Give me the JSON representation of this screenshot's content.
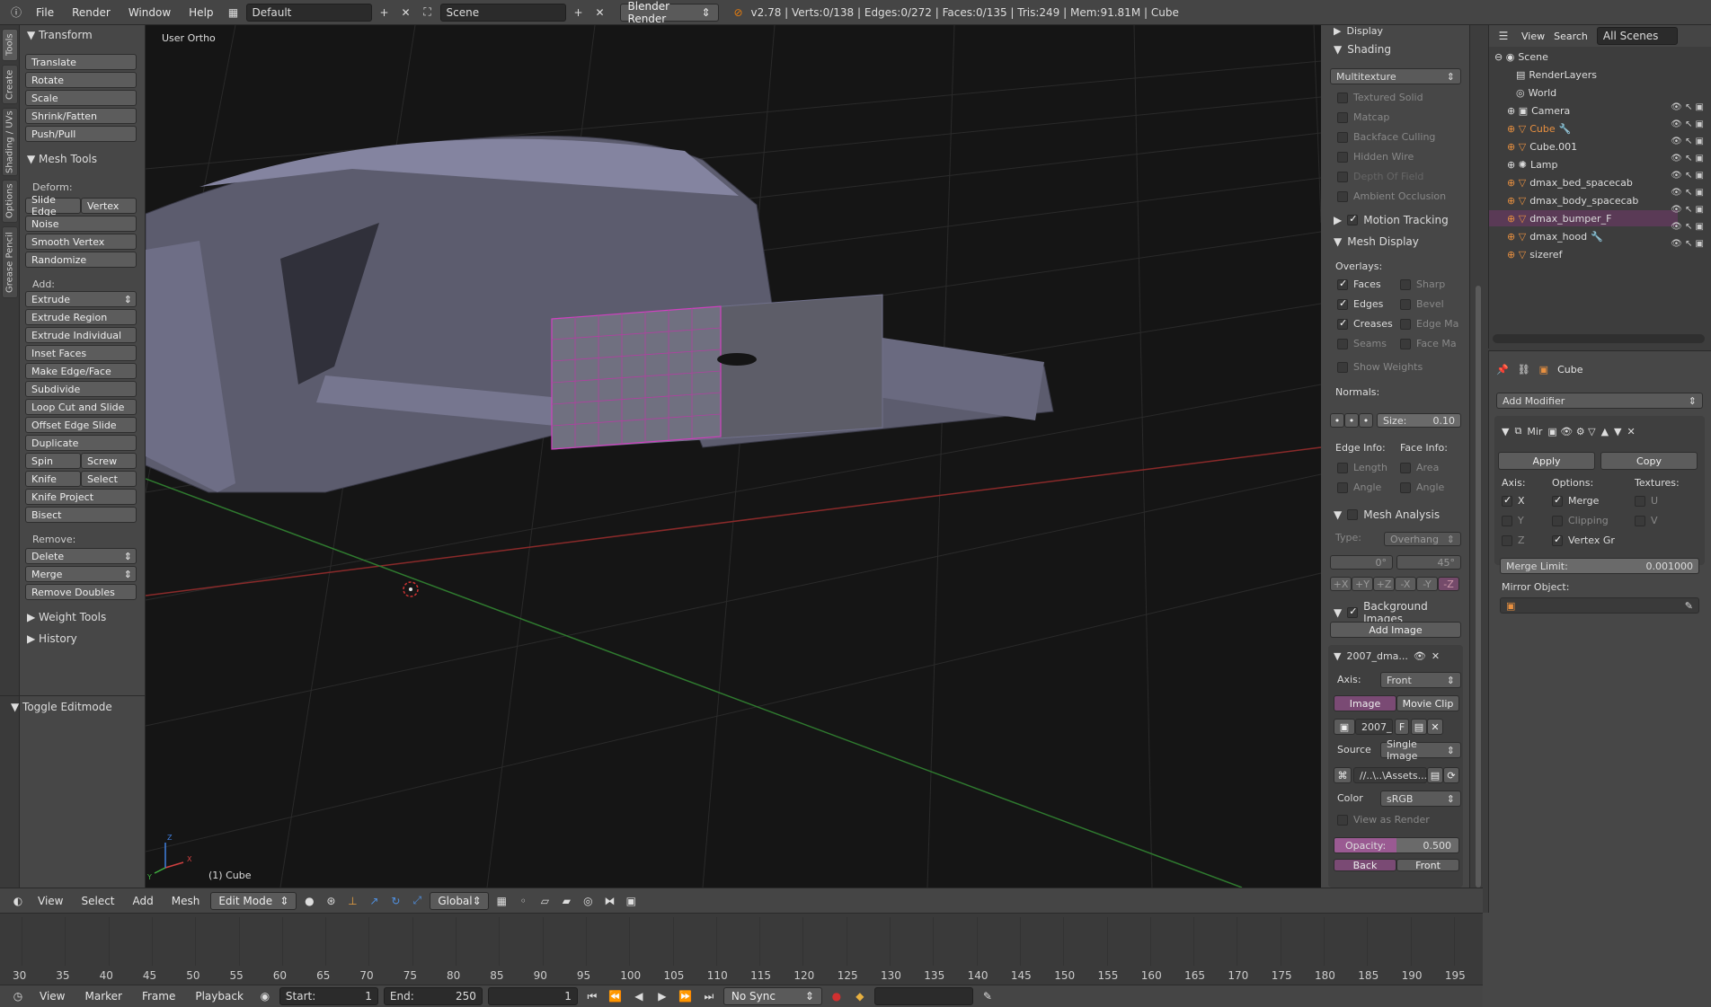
{
  "topbar": {
    "menus": [
      "File",
      "Render",
      "Window",
      "Help"
    ],
    "layout": "Default",
    "scene": "Scene",
    "engine": "Blender Render",
    "stats": "v2.78 | Verts:0/138 | Edges:0/272 | Faces:0/135 | Tris:249 | Mem:91.81M | Cube"
  },
  "tabs": [
    "Tools",
    "Create",
    "Shading / UVs",
    "Options",
    "Grease Pencil"
  ],
  "toolshelf": {
    "transform_header": "Transform",
    "transform": [
      "Translate",
      "Rotate",
      "Scale",
      "Shrink/Fatten",
      "Push/Pull"
    ],
    "mesh_tools_header": "Mesh Tools",
    "deform_label": "Deform:",
    "slide_edge": "Slide Edge",
    "vertex": "Vertex",
    "deform": [
      "Noise",
      "Smooth Vertex",
      "Randomize"
    ],
    "add_label": "Add:",
    "extrude": "Extrude",
    "add": [
      "Extrude Region",
      "Extrude Individual",
      "Inset Faces",
      "Make Edge/Face",
      "Subdivide",
      "Loop Cut and Slide",
      "Offset Edge Slide",
      "Duplicate"
    ],
    "spin": "Spin",
    "screw": "Screw",
    "knife": "Knife",
    "select": "Select",
    "knife_project": "Knife Project",
    "bisect": "Bisect",
    "remove_label": "Remove:",
    "delete": "Delete",
    "merge": "Merge",
    "remove_doubles": "Remove Doubles",
    "weight_tools": "Weight Tools",
    "history": "History",
    "toggle_editmode": "Toggle Editmode"
  },
  "viewport": {
    "view_label": "User Ortho",
    "object_label": "(1) Cube",
    "axis_x": "X",
    "axis_y": "Y",
    "axis_z": "Z"
  },
  "props": {
    "display": "Display",
    "shading": "Shading",
    "shading_mode": "Multitexture",
    "shading_opts": [
      "Textured Solid",
      "Matcap",
      "Backface Culling",
      "Hidden Wire",
      "Depth Of Field",
      "Ambient Occlusion"
    ],
    "motion_tracking": "Motion Tracking",
    "mesh_display": "Mesh Display",
    "overlays": "Overlays:",
    "faces": "Faces",
    "edges": "Edges",
    "creases": "Creases",
    "seams": "Seams",
    "sharp": "Sharp",
    "bevel": "Bevel",
    "edge_ma": "Edge Ma",
    "face_ma": "Face Ma",
    "show_weights": "Show Weights",
    "normals": "Normals:",
    "size": "Size:",
    "size_val": "0.10",
    "edge_info": "Edge Info:",
    "face_info": "Face Info:",
    "length": "Length",
    "angle1": "Angle",
    "area": "Area",
    "angle2": "Angle",
    "mesh_analysis": "Mesh Analysis",
    "type_label": "Type:",
    "type_val": "Overhang",
    "min_angle": "0°",
    "max_angle": "45°",
    "axes": [
      "+X",
      "+Y",
      "+Z",
      "-X",
      "-Y",
      "-Z"
    ],
    "bg_images": "Background Images",
    "add_image": "Add Image",
    "img_name": "2007_dma...",
    "axis_label": "Axis:",
    "axis_val": "Front",
    "image_tab": "Image",
    "movie_clip_tab": "Movie Clip",
    "img_field": "2007_",
    "f_label": "F",
    "source_label": "Source",
    "source_val": "Single Image",
    "path_val": "//..\\..\\Assets...",
    "color_label": "Color",
    "color_val": "sRGB",
    "view_as_render": "View as Render",
    "opacity_label": "Opacity:",
    "opacity_val": "0.500",
    "opacity_frac": 0.5,
    "back_label": "Back",
    "front_label": "Front"
  },
  "outliner": {
    "view": "View",
    "search": "Search",
    "all_scenes": "All Scenes",
    "items": [
      "Scene",
      "RenderLayers",
      "World",
      "Camera",
      "Cube",
      "Cube.001",
      "Lamp",
      "dmax_bed_spacecab",
      "dmax_body_spacecab",
      "dmax_bumper_F",
      "dmax_hood",
      "sizeref"
    ]
  },
  "modifier": {
    "object": "Cube",
    "add_modifier": "Add Modifier",
    "mod_name": "Mir",
    "apply": "Apply",
    "copy": "Copy",
    "axis_label": "Axis:",
    "options_label": "Options:",
    "textures_label": "Textures:",
    "x": "X",
    "y": "Y",
    "z": "Z",
    "merge": "Merge",
    "clipping": "Clipping",
    "vertex_gr": "Vertex Gr",
    "u": "U",
    "v": "V",
    "merge_limit_label": "Merge Limit:",
    "merge_limit_val": "0.001000",
    "mirror_object": "Mirror Object:"
  },
  "vheader": {
    "menus": [
      "View",
      "Select",
      "Add",
      "Mesh"
    ],
    "mode": "Edit Mode",
    "orientation": "Global"
  },
  "timeline": {
    "ticks": [
      "30",
      "35",
      "40",
      "45",
      "50",
      "55",
      "60",
      "65",
      "70",
      "75",
      "80",
      "85",
      "90",
      "95",
      "100",
      "105",
      "110",
      "115",
      "120",
      "125",
      "130",
      "135",
      "140",
      "145",
      "150",
      "155",
      "160",
      "165",
      "170",
      "175",
      "180",
      "185",
      "190",
      "195"
    ],
    "menus": [
      "View",
      "Marker",
      "Frame",
      "Playback"
    ],
    "start_label": "Start:",
    "start_val": "1",
    "end_label": "End:",
    "end_val": "250",
    "current": "1",
    "sync": "No Sync"
  }
}
